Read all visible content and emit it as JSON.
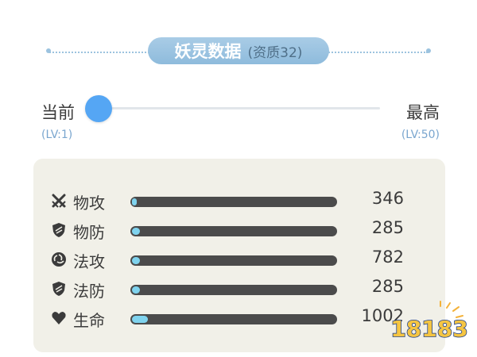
{
  "header": {
    "title": "妖灵数据",
    "subtitle": "(资质32)"
  },
  "level": {
    "current_label": "当前",
    "current_value": "(LV:1)",
    "max_label": "最高",
    "max_value": "(LV:50)",
    "slider_fraction": 0.0
  },
  "stats": [
    {
      "icon": "crossed-swords-icon",
      "label": "物攻",
      "value": "346",
      "fill_fraction": 0.02
    },
    {
      "icon": "shield-icon",
      "label": "物防",
      "value": "285",
      "fill_fraction": 0.04
    },
    {
      "icon": "swirl-icon",
      "label": "法攻",
      "value": "782",
      "fill_fraction": 0.04
    },
    {
      "icon": "shield-icon",
      "label": "法防",
      "value": "285",
      "fill_fraction": 0.04
    },
    {
      "icon": "heart-icon",
      "label": "生命",
      "value": "1002",
      "fill_fraction": 0.08
    }
  ],
  "logo_text": "18183",
  "colors": {
    "accent": "#55a6f4",
    "title_pill": "#9cc3df",
    "bar_track": "#4b4b4b",
    "bar_fill": "#7fd3ee",
    "panel_bg": "#f1f0e8"
  }
}
